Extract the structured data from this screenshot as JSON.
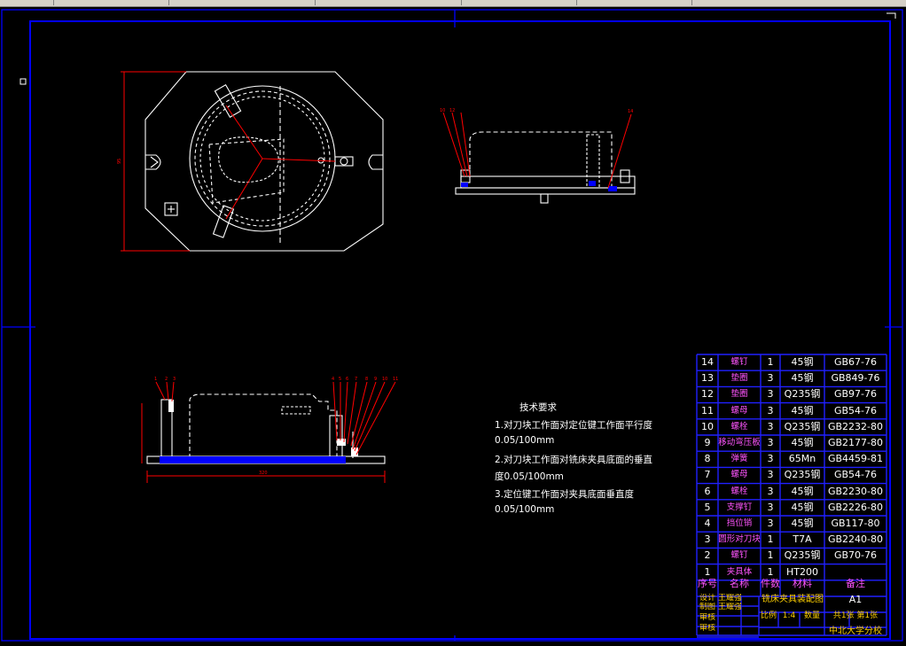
{
  "window": {
    "toolbar_segments": 6
  },
  "colors": {
    "frame": "#0000ff",
    "drawing": "#ffffff",
    "leader": "#ff0000",
    "dimension": "#ff0000",
    "hidden_line": "#ffffff",
    "base_plate": "#0000ff",
    "bom_grid": "#2020ff",
    "bom_text_name": "#ff55ff",
    "bom_text_value": "#ffffff",
    "title_text": "#ffd000"
  },
  "tech_requirements": {
    "title": "技术要求",
    "lines": [
      "1.对刀块工作面对定位键工作面平行度",
      "0.05/100mm",
      "2.对刀块工作面对铣床夹具底面的垂直",
      "度0.05/100mm",
      "3.定位键工作面对夹具底面垂直度",
      "0.05/100mm"
    ]
  },
  "bom": {
    "rows": [
      {
        "no": "14",
        "name": "螺钉",
        "qty": "1",
        "material": "45钢",
        "standard": "GB67-76"
      },
      {
        "no": "13",
        "name": "垫圈",
        "qty": "3",
        "material": "45钢",
        "standard": "GB849-76"
      },
      {
        "no": "12",
        "name": "垫圈",
        "qty": "3",
        "material": "Q235钢",
        "standard": "GB97-76"
      },
      {
        "no": "11",
        "name": "螺母",
        "qty": "3",
        "material": "45钢",
        "standard": "GB54-76"
      },
      {
        "no": "10",
        "name": "螺栓",
        "qty": "3",
        "material": "Q235钢",
        "standard": "GB2232-80"
      },
      {
        "no": "9",
        "name": "移动弯压板",
        "qty": "3",
        "material": "45钢",
        "standard": "GB2177-80"
      },
      {
        "no": "8",
        "name": "弹簧",
        "qty": "3",
        "material": "65Mn",
        "standard": "GB4459-81"
      },
      {
        "no": "7",
        "name": "螺母",
        "qty": "3",
        "material": "Q235钢",
        "standard": "GB54-76"
      },
      {
        "no": "6",
        "name": "螺栓",
        "qty": "3",
        "material": "45钢",
        "standard": "GB2230-80"
      },
      {
        "no": "5",
        "name": "支撑钉",
        "qty": "3",
        "material": "45钢",
        "standard": "GB2226-80"
      },
      {
        "no": "4",
        "name": "挡位销",
        "qty": "3",
        "material": "45钢",
        "standard": "GB117-80"
      },
      {
        "no": "3",
        "name": "圆形对刀块",
        "qty": "1",
        "material": "T7A",
        "standard": "GB2240-80"
      },
      {
        "no": "2",
        "name": "螺钉",
        "qty": "1",
        "material": "Q235钢",
        "standard": "GB70-76"
      },
      {
        "no": "1",
        "name": "夹具体",
        "qty": "1",
        "material": "HT200",
        "standard": ""
      }
    ],
    "header": {
      "no": "序号",
      "name": "名称",
      "qty": "件数",
      "material": "材料",
      "note": "备注"
    }
  },
  "title_block": {
    "drawing_name": "铣床夹具装配图",
    "sheet_size": "A1",
    "designer_label": "设计",
    "checker_label": "制图",
    "reviewer_label": "审核",
    "approver_label": "审核",
    "designer_name": "王耀强",
    "checker_name": "王耀强",
    "scale_label": "比例",
    "scale": "1:4",
    "qty_label": "数量",
    "sheets": "共1张 第1张",
    "school": "中北大学分校"
  },
  "leader_numbers_top": [
    "10",
    "12",
    "14"
  ],
  "leader_numbers_bottom": [
    "1",
    "2",
    "3",
    "4",
    "5",
    "6",
    "7",
    "8",
    "9",
    "10",
    "11"
  ]
}
